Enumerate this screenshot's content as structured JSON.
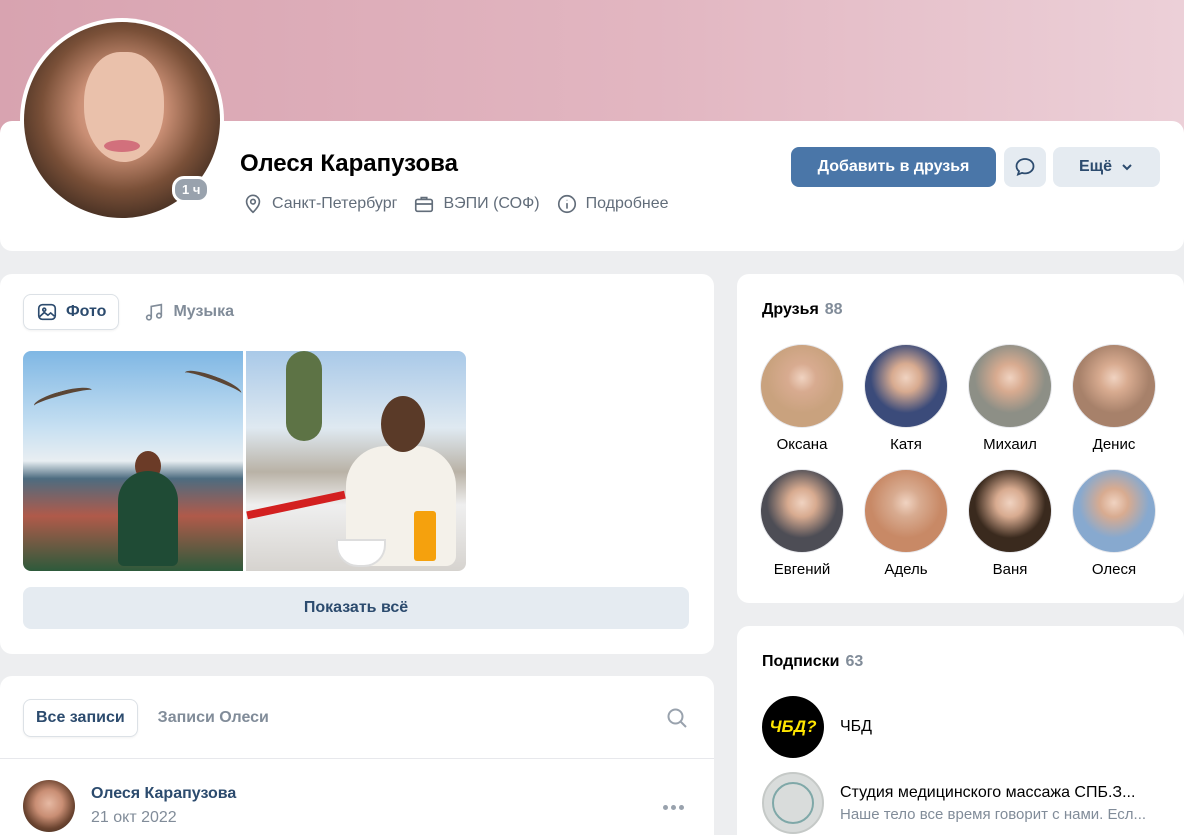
{
  "profile": {
    "name": "Олеся Карапузова",
    "online": "1 ч",
    "city": "Санкт-Петербург",
    "education": "ВЭПИ (СОФ)",
    "details": "Подробнее",
    "add_friend": "Добавить в друзья",
    "more": "Ещё",
    "icons": [
      "location-pin-icon",
      "briefcase-icon",
      "info-icon",
      "message-icon",
      "chevron-down-icon"
    ]
  },
  "media": {
    "tab_photos": "Фото",
    "tab_music": "Музыка",
    "show_all": "Показать всё"
  },
  "wall": {
    "tab_all": "Все записи",
    "tab_own": "Записи Олеси",
    "post": {
      "author": "Олеся Карапузова",
      "date": "21 окт 2022"
    }
  },
  "friends": {
    "title": "Друзья",
    "count": "88",
    "items": [
      {
        "name": "Оксана",
        "color": "#c9a27e"
      },
      {
        "name": "Катя",
        "color": "#3b4b7a"
      },
      {
        "name": "Михаил",
        "color": "#8d8f86"
      },
      {
        "name": "Денис",
        "color": "#a7816a"
      },
      {
        "name": "Евгений",
        "color": "#4d4d55"
      },
      {
        "name": "Адель",
        "color": "#c88966"
      },
      {
        "name": "Ваня",
        "color": "#3a2a1e"
      },
      {
        "name": "Олеся",
        "color": "#87a9cf"
      }
    ]
  },
  "subscriptions": {
    "title": "Подписки",
    "count": "63",
    "items": [
      {
        "name": "ЧБД",
        "logo": "ЧБД?",
        "desc": ""
      },
      {
        "name": "Студия медицинского массажа СПБ.З...",
        "desc": "Наше тело все время говорит с нами. Есл..."
      }
    ]
  },
  "colors": {
    "accent": "#4a76a8",
    "link": "#2c4b6e",
    "secondary": "#818c99"
  }
}
